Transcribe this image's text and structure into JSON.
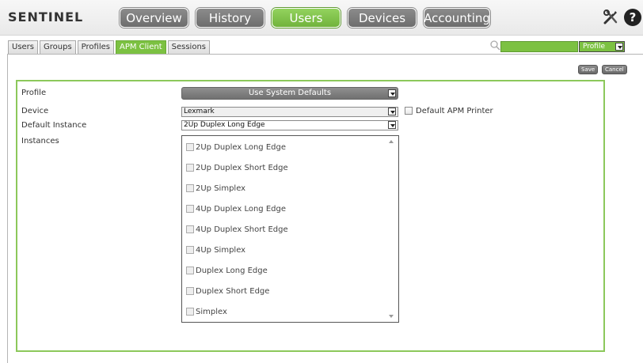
{
  "header": {
    "logo": "SENTINEL",
    "nav": [
      "Overview",
      "History",
      "Users",
      "Devices",
      "Accounting"
    ],
    "active_nav": "Users",
    "tools_icon": "tools-icon",
    "help_icon": "help-icon",
    "help_glyph": "?"
  },
  "subtabs": [
    "Users",
    "Groups",
    "Profiles",
    "APM Client",
    "Sessions"
  ],
  "active_subtab": "APM Client",
  "search": {
    "icon": "search-icon",
    "value": "",
    "filter_selected": "Profile"
  },
  "actions": {
    "save": "Save",
    "cancel": "Cancel"
  },
  "form": {
    "profile_label": "Profile",
    "profile_value": "Use System Defaults",
    "device_label": "Device",
    "device_value": "Lexmark",
    "default_apm_label": "Default APM Printer",
    "default_instance_label": "Default Instance",
    "default_instance_value": "2Up Duplex Long Edge",
    "instances_label": "Instances",
    "instances": [
      "2Up Duplex Long Edge",
      "2Up Duplex Short Edge",
      "2Up Simplex",
      "4Up Duplex Long Edge",
      "4Up Duplex Short Edge",
      "4Up Simplex",
      "Duplex Long Edge",
      "Duplex Short Edge",
      "Simplex"
    ]
  },
  "colors": {
    "accent": "#7cc142",
    "nav_inactive": "#7d7d7d",
    "panel_border": "#8cc85b"
  }
}
